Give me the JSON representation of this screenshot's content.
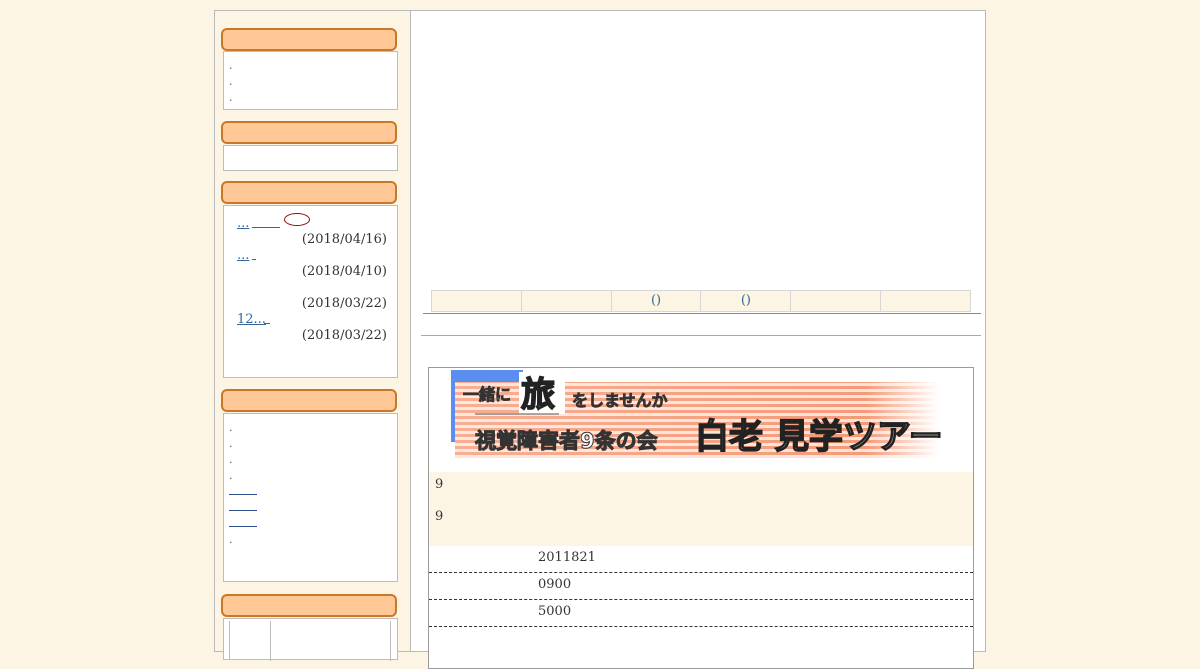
{
  "recent_entries": [
    {
      "link": "...",
      "date": "(2018/04/16)"
    },
    {
      "link": "...",
      "date": "(2018/04/10)"
    },
    {
      "link": "",
      "date": "(2018/03/22)"
    },
    {
      "link": "12...",
      "date": "(2018/03/22)"
    }
  ],
  "tabs": [
    "",
    "",
    "()",
    "()",
    "",
    ""
  ],
  "banner": {
    "line1_prefix": "一緒に",
    "line1_big": "旅",
    "line1_suffix": "をしませんか",
    "line2_main": "視覚障害者9条の会",
    "line2_big": "白老 見学ツアー"
  },
  "notes": [
    "9",
    "9"
  ],
  "details": [
    "2011821",
    "0900",
    "5000"
  ],
  "colors": {
    "page_bg": "#fdf5e4",
    "header_fill": "#ffc896",
    "header_border": "#c9782a",
    "link": "#336699",
    "banner_blue": "#5b8ef0",
    "banner_stripe": "#f59a78"
  }
}
